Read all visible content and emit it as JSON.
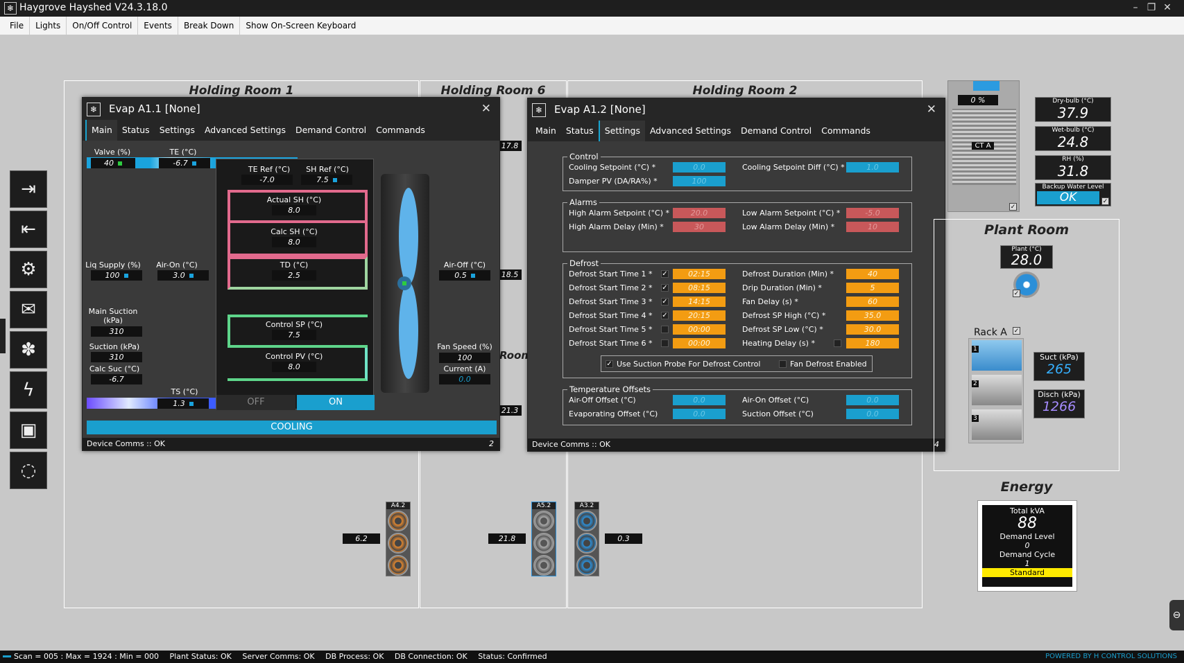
{
  "app": {
    "title": "Haygrove Hayshed V24.3.18.0",
    "icon": "snowflake-app-icon"
  },
  "menu": [
    "File",
    "Lights",
    "On/Off Control",
    "Events",
    "Break Down",
    "Show On-Screen Keyboard"
  ],
  "sidebar": [
    {
      "icon": "login-icon",
      "glyph": "⇥"
    },
    {
      "icon": "logout-icon",
      "glyph": "⇤"
    },
    {
      "icon": "user-settings-icon",
      "glyph": "⚙"
    },
    {
      "icon": "mail-icon",
      "glyph": "✉"
    },
    {
      "icon": "fan-control-icon",
      "glyph": "✽"
    },
    {
      "icon": "power-icon",
      "glyph": "ϟ"
    },
    {
      "icon": "save-icon",
      "glyph": "▣"
    },
    {
      "icon": "refresh-icon",
      "glyph": "◌"
    }
  ],
  "rooms": {
    "r1": "Holding Room 1",
    "r6": "Holding Room 6",
    "r2": "Holding Room 2",
    "partial": "Room"
  },
  "win1": {
    "title": "Evap A1.1 [None]",
    "tabs": [
      "Main",
      "Status",
      "Settings",
      "Advanced Settings",
      "Demand Control",
      "Commands"
    ],
    "active_tab": "Main",
    "valve_lbl": "Valve (%)",
    "valve": "40",
    "te_lbl": "TE (°C)",
    "te": "-6.7",
    "teref_lbl": "TE Ref (°C)",
    "teref": "-7.0",
    "shref_lbl": "SH Ref (°C)",
    "shref": "7.5",
    "actsh_lbl": "Actual SH (°C)",
    "actsh": "8.0",
    "calcsh_lbl": "Calc SH (°C)",
    "calcsh": "8.0",
    "td_lbl": "TD (°C)",
    "td": "2.5",
    "csp_lbl": "Control SP (°C)",
    "csp": "7.5",
    "cpv_lbl": "Control PV (°C)",
    "cpv": "8.0",
    "liq_lbl": "Liq Supply (%)",
    "liq": "100",
    "airon_lbl": "Air-On (°C)",
    "airon": "3.0",
    "mainsuc_lbl": "Main Suction (kPa)",
    "mainsuc": "310",
    "suc_lbl": "Suction (kPa)",
    "suc": "310",
    "calcsuc_lbl": "Calc Suc (°C)",
    "calcsuc": "-6.7",
    "ts_lbl": "TS (°C)",
    "ts": "1.3",
    "off": "OFF",
    "on": "ON",
    "airoff_lbl": "Air-Off (°C)",
    "airoff": "0.5",
    "fanspeed_lbl": "Fan Speed (%)",
    "fanspeed": "100",
    "current_lbl": "Current (A)",
    "current": "0.0",
    "mode": "COOLING",
    "comms": "Device Comms :: OK",
    "num": "2"
  },
  "win2": {
    "title": "Evap A1.2 [None]",
    "tabs": [
      "Main",
      "Status",
      "Settings",
      "Advanced Settings",
      "Demand Control",
      "Commands"
    ],
    "active_tab": "Settings",
    "control": {
      "title": "Control",
      "cool_sp_lbl": "Cooling Setpoint (°C) *",
      "cool_sp": "0.0",
      "cool_diff_lbl": "Cooling Setpoint Diff (°C) *",
      "cool_diff": "1.0",
      "damper_lbl": "Damper PV (DA/RA%) *",
      "damper": "100"
    },
    "alarms": {
      "title": "Alarms",
      "high_sp_lbl": "High Alarm Setpoint (°C) *",
      "high_sp": "20.0",
      "low_sp_lbl": "Low Alarm Setpoint (°C) *",
      "low_sp": "-5.0",
      "high_delay_lbl": "High Alarm Delay (Min) *",
      "high_delay": "30",
      "low_delay_lbl": "Low Alarm Delay (Min) *",
      "low_delay": "10"
    },
    "defrost": {
      "title": "Defrost",
      "starts": [
        {
          "label": "Defrost Start Time 1 *",
          "on": true,
          "time": "02:15"
        },
        {
          "label": "Defrost Start Time 2 *",
          "on": true,
          "time": "08:15"
        },
        {
          "label": "Defrost Start Time 3 *",
          "on": true,
          "time": "14:15"
        },
        {
          "label": "Defrost Start Time 4 *",
          "on": true,
          "time": "20:15"
        },
        {
          "label": "Defrost Start Time 5 *",
          "on": false,
          "time": "00:00"
        },
        {
          "label": "Defrost Start Time 6 *",
          "on": false,
          "time": "00:00"
        }
      ],
      "right": [
        {
          "label": "Defrost Duration (Min) *",
          "val": "40"
        },
        {
          "label": "Drip Duration (Min) *",
          "val": "5"
        },
        {
          "label": "Fan Delay (s) *",
          "val": "60"
        },
        {
          "label": "Defrost SP High (°C) *",
          "val": "35.0"
        },
        {
          "label": "Defrost SP Low (°C) *",
          "val": "30.0"
        },
        {
          "label": "Heating Delay (s) *",
          "val": "180"
        }
      ],
      "opt1": "Use Suction Probe For Defrost Control",
      "opt2": "Fan Defrost Enabled"
    },
    "offsets": {
      "title": "Temperature Offsets",
      "airoff_lbl": "Air-Off Offset (°C)",
      "airoff": "0.0",
      "airon_lbl": "Air-On Offset (°C)",
      "airon": "0.0",
      "evap_lbl": "Evaporating Offset (°C)",
      "evap": "0.0",
      "suc_lbl": "Suction Offset (°C)",
      "suc": "0.0"
    },
    "comms": "Device Comms :: OK",
    "num": "4"
  },
  "edge_vals": {
    "a": "17.8",
    "b": "18.5",
    "c": "21.3"
  },
  "ct": {
    "label": "CT A",
    "pct_val": "0",
    "pct": "%"
  },
  "weather": {
    "dry_lbl": "Dry-bulb (°C)",
    "dry": "37.9",
    "wet_lbl": "Wet-bulb (°C)",
    "wet": "24.8",
    "rh_lbl": "RH (%)",
    "rh": "31.8",
    "bwl_lbl": "Backup Water Level",
    "bwl": "OK"
  },
  "plant": {
    "title": "Plant Room",
    "plant_lbl": "Plant (°C)",
    "plant": "28.0",
    "rack": "Rack A",
    "suct_lbl": "Suct (kPa)",
    "suct": "265",
    "disch_lbl": "Disch (kPa)",
    "disch": "1266",
    "comp": [
      "1",
      "2",
      "3"
    ]
  },
  "energy": {
    "title": "Energy",
    "kva_lbl": "Total kVA",
    "kva": "88",
    "dl_lbl": "Demand Level",
    "dl": "0",
    "dc_lbl": "Demand Cycle",
    "dc": "1",
    "mode": "Standard"
  },
  "units": [
    {
      "name": "A4.2",
      "val": "6.2"
    },
    {
      "name": "A5.2",
      "val": "21.8"
    },
    {
      "name": "A3.2",
      "val": "0.3"
    }
  ],
  "status": {
    "scan": "Scan = 005 : Max = 1924 : Min = 000",
    "plant": "Plant Status: OK",
    "server": "Server Comms: OK",
    "dbp": "DB Process:  OK",
    "dbc": "DB Connection:  OK",
    "st": "Status:  Confirmed",
    "powered": "POWERED BY H CONTROL SOLUTIONS"
  },
  "colors": {
    "accent": "#1a9fce",
    "alarm": "#c8585a",
    "defrost": "#f39c12"
  }
}
